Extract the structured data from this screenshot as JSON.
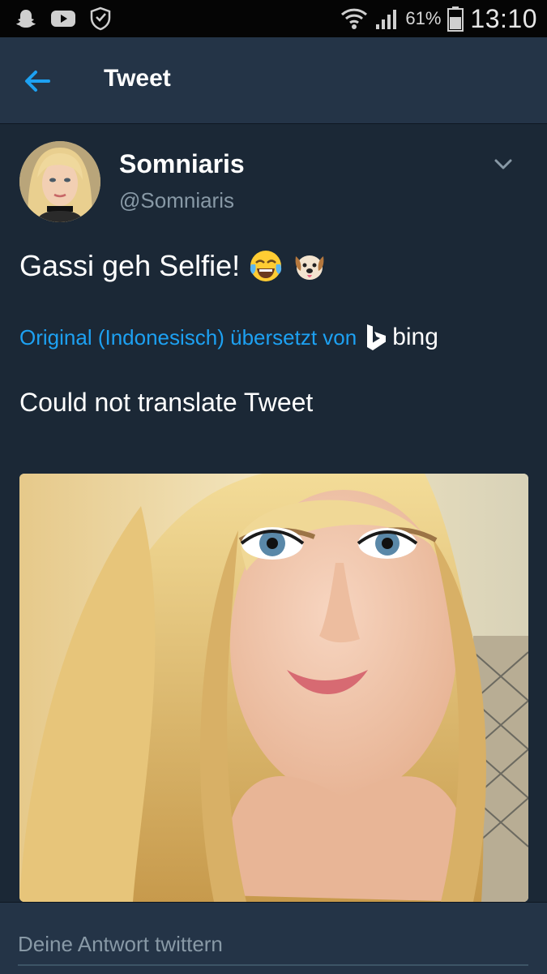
{
  "status_bar": {
    "icons_left": [
      "snapchat-icon",
      "youtube-icon",
      "shield-app-icon"
    ],
    "battery_percent": "61%",
    "time": "13:10"
  },
  "header": {
    "title": "Tweet"
  },
  "tweet": {
    "author_name": "Somniaris",
    "author_handle": "@Somniaris",
    "text": "Gassi geh Selfie!",
    "emojis": [
      "face-with-tears-of-joy",
      "dog-face"
    ],
    "translation_label": "Original (Indonesisch) übersetzt von",
    "translation_provider": "bing",
    "translation_result": "Could not translate Tweet"
  },
  "reply": {
    "placeholder": "Deine Antwort twittern"
  },
  "colors": {
    "background": "#1b2836",
    "header": "#243447",
    "accent": "#1da1f2",
    "secondary_text": "#8899a6"
  }
}
